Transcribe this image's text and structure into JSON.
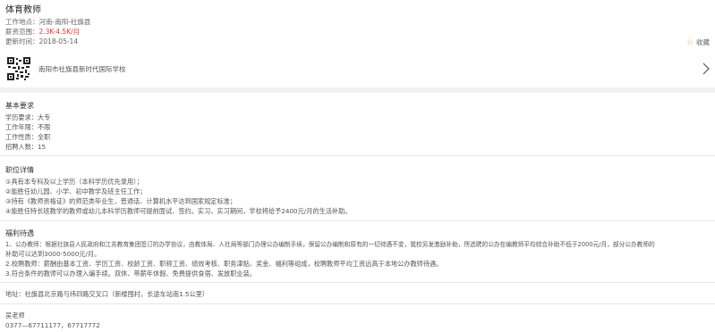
{
  "job": {
    "title": "体育教师",
    "location_label": "工作地点：",
    "location": "河南-南阳-社旗县",
    "salary_label": "薪资范围：",
    "salary": "2.3K-4.5K/月",
    "updated_label": "更新时间：",
    "updated": "2018-05-14",
    "collect_label": "收藏"
  },
  "school": {
    "name": "南阳市社旗县新时代国际学校"
  },
  "basic": {
    "title": "基本要求",
    "items": [
      {
        "label": "学历要求：",
        "value": "大专"
      },
      {
        "label": "工作年限：",
        "value": "不限"
      },
      {
        "label": "工作性质：",
        "value": "全职"
      },
      {
        "label": "招聘人数：",
        "value": "15"
      }
    ]
  },
  "details": {
    "title": "职位详情",
    "lines": [
      "①具有本专科及以上学历（本科学历优先录用）；",
      "②能胜任幼儿园、小学、初中教学及班主任工作；",
      "③持有《教师资格证》的师范类毕业生，普通话、计算机水平达到国家规定标准；",
      "④能胜任特长班教学的教师或幼儿本科学历教师可提前面试、签约。实习，实习期间，学校将给予2400元/月的生活补助。"
    ]
  },
  "welfare": {
    "title": "福利待遇",
    "lines": [
      "1、公办教师：根据社旗县人民政府和江苏教育集团签订的办学协议，由教体局、人社局等部门办理公办编制手续，保留公办编制和原有的一切待遇不变，我校另发激励补助，所选聘的公办在编教师平均综合补助不低于2000元/月，部分公办教师的",
      "补助可以达到3000-5000元/月。",
      "2.校聘教师：薪酬由基本工资、学历工资、校龄工资、职称工资、绩效考核、职务津贴、奖金、福利等组成，校聘教师平均工资远高于本地公办教师待遇。",
      "3.符合条件的教师可以办理入编手续。双休、带薪年休假、免费提供食宿、发放职业装。"
    ]
  },
  "address": {
    "text": "地址：社旗县北京路与纬四路交叉口（新楼囤村，长途车站南1.5公里）"
  },
  "contact": {
    "name": "吴老师",
    "phone": "0377—67711177，67717772"
  },
  "colors": {
    "salary": "#e4393c",
    "star": "#f5a623",
    "band": "#f2f2f2"
  }
}
